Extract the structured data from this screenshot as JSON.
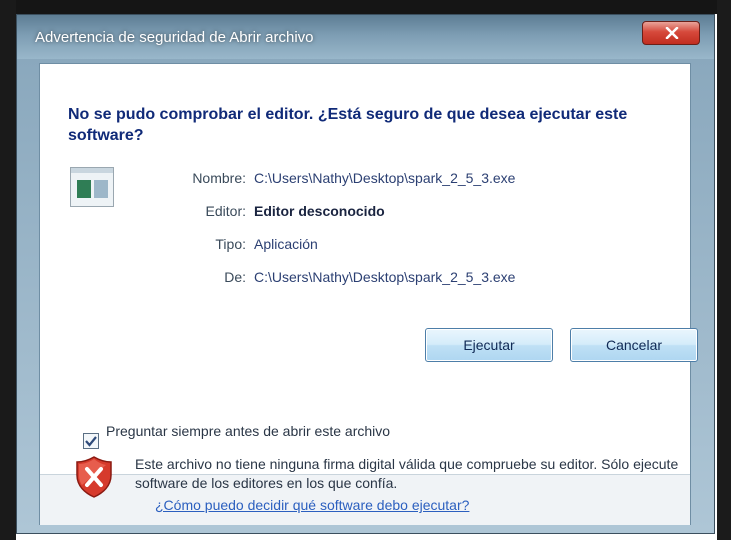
{
  "window": {
    "title": "Advertencia de seguridad de Abrir archivo"
  },
  "dialog": {
    "heading": "No se pudo comprobar el editor. ¿Está seguro de que desea ejecutar este software?",
    "properties": [
      {
        "label": "Nombre:",
        "value": "C:\\Users\\Nathy\\Desktop\\spark_2_5_3.exe"
      },
      {
        "label": "Editor:",
        "value": "Editor desconocido"
      },
      {
        "label": "Tipo:",
        "value": "Aplicación"
      },
      {
        "label": "De:",
        "value": "C:\\Users\\Nathy\\Desktop\\spark_2_5_3.exe"
      }
    ],
    "run_button": "Ejecutar",
    "cancel_button": "Cancelar",
    "checkbox_label": "Preguntar siempre antes de abrir este archivo",
    "checkbox_checked": true,
    "footer_text": "Este archivo no tiene ninguna firma digital válida que compruebe su editor. Sólo ejecute software de los editores en los que confía.",
    "footer_link": "¿Cómo puedo decidir qué software debo ejecutar?"
  },
  "colors": {
    "heading": "#102a78",
    "link": "#2b5fbf",
    "close_button": "#c12d20"
  },
  "icons": [
    "close-icon",
    "application-file-icon",
    "checkmark-icon",
    "shield-warning-icon"
  ]
}
